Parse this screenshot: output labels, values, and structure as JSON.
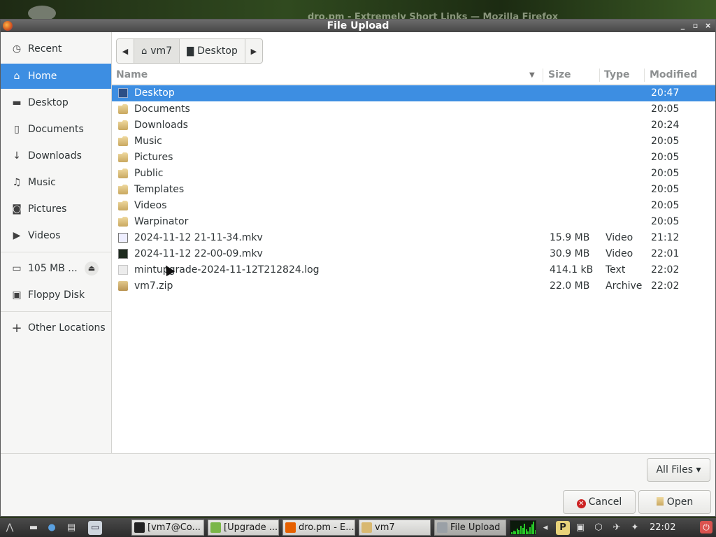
{
  "background_window": {
    "title": "dro.pm - Extremely Short Links — Mozilla Firefox"
  },
  "dialog": {
    "title": "File Upload",
    "wm_buttons": [
      "_",
      "▫",
      "×"
    ]
  },
  "sidebar": {
    "items": [
      {
        "label": "Recent",
        "icon": "clock-icon",
        "glyph": "◷"
      },
      {
        "label": "Home",
        "icon": "home-icon",
        "glyph": "⌂",
        "active": true
      },
      {
        "label": "Desktop",
        "icon": "desktop-folder-icon",
        "glyph": "▬"
      },
      {
        "label": "Documents",
        "icon": "document-icon",
        "glyph": "▯"
      },
      {
        "label": "Downloads",
        "icon": "download-icon",
        "glyph": "↓"
      },
      {
        "label": "Music",
        "icon": "music-icon",
        "glyph": "♫"
      },
      {
        "label": "Pictures",
        "icon": "camera-icon",
        "glyph": "◙"
      },
      {
        "label": "Videos",
        "icon": "video-icon",
        "glyph": "▶"
      }
    ],
    "devices": [
      {
        "label": "105 MB ...",
        "icon": "drive-icon",
        "glyph": "▭",
        "eject": "⏏"
      },
      {
        "label": "Floppy Disk",
        "icon": "floppy-icon",
        "glyph": "▣"
      }
    ],
    "other": {
      "label": "Other Locations",
      "icon": "plus-icon",
      "glyph": "+"
    }
  },
  "pathbar": {
    "back": "◀",
    "forward": "▶",
    "crumbs": [
      {
        "label": "vm7",
        "icon": "home-icon",
        "glyph": "⌂",
        "selected": true
      },
      {
        "label": "Desktop",
        "icon": "folder-icon",
        "glyph": "▇"
      }
    ]
  },
  "columns": {
    "name": "Name",
    "size": "Size",
    "type": "Type",
    "modified": "Modified",
    "sort_glyph": "▼"
  },
  "files": [
    {
      "name": "Desktop",
      "size": "",
      "type": "",
      "modified": "20:47",
      "kind": "desktop",
      "selected": true
    },
    {
      "name": "Documents",
      "size": "",
      "type": "",
      "modified": "20:05",
      "kind": "folder"
    },
    {
      "name": "Downloads",
      "size": "",
      "type": "",
      "modified": "20:24",
      "kind": "folder"
    },
    {
      "name": "Music",
      "size": "",
      "type": "",
      "modified": "20:05",
      "kind": "folder"
    },
    {
      "name": "Pictures",
      "size": "",
      "type": "",
      "modified": "20:05",
      "kind": "folder"
    },
    {
      "name": "Public",
      "size": "",
      "type": "",
      "modified": "20:05",
      "kind": "folder"
    },
    {
      "name": "Templates",
      "size": "",
      "type": "",
      "modified": "20:05",
      "kind": "folder"
    },
    {
      "name": "Videos",
      "size": "",
      "type": "",
      "modified": "20:05",
      "kind": "folder"
    },
    {
      "name": "Warpinator",
      "size": "",
      "type": "",
      "modified": "20:05",
      "kind": "folder"
    },
    {
      "name": "2024-11-12 21-11-34.mkv",
      "size": "15.9 MB",
      "type": "Video",
      "modified": "21:12",
      "kind": "video-light"
    },
    {
      "name": "2024-11-12 22-00-09.mkv",
      "size": "30.9 MB",
      "type": "Video",
      "modified": "22:01",
      "kind": "video"
    },
    {
      "name": "mintupgrade-2024-11-12T212824.log",
      "size": "414.1 kB",
      "type": "Text",
      "modified": "22:02",
      "kind": "text"
    },
    {
      "name": "vm7.zip",
      "size": "22.0 MB",
      "type": "Archive",
      "modified": "22:02",
      "kind": "zip"
    }
  ],
  "filter": {
    "label": "All Files",
    "glyph": "▾"
  },
  "buttons": {
    "cancel": "Cancel",
    "open": "Open"
  },
  "taskbar": {
    "tasks": [
      {
        "label": "[vm7@Co...",
        "icon": "terminal-icon",
        "color": "#222222"
      },
      {
        "label": "[Upgrade ...",
        "icon": "upgrade-icon",
        "color": "#7ab648"
      },
      {
        "label": "dro.pm - E...",
        "icon": "firefox-icon",
        "color": "#e66000"
      },
      {
        "label": "vm7",
        "icon": "folder-icon",
        "color": "#d8b870"
      },
      {
        "label": "File Upload",
        "icon": "dialog-icon",
        "color": "#9aa0a6",
        "active": true
      }
    ],
    "clock": "22:02",
    "colors": {
      "accent": "#3d8ee2",
      "selected_text": "#ffffff"
    }
  }
}
